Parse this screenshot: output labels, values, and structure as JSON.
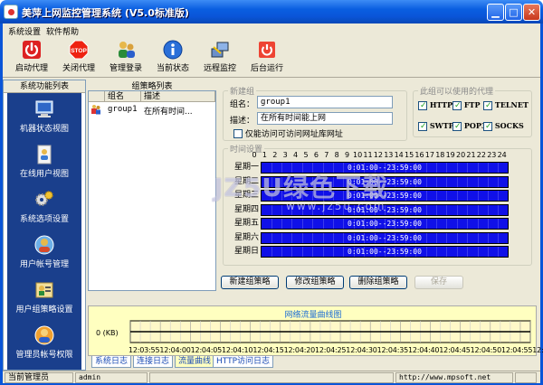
{
  "window": {
    "title": "美萍上网监控管理系统 (V5.0标准版)"
  },
  "menu": {
    "items": [
      "系统设置",
      "软件帮助"
    ]
  },
  "toolbar": {
    "items": [
      {
        "label": "启动代理",
        "icon": "power-on-icon"
      },
      {
        "label": "关闭代理",
        "icon": "stop-sign-icon"
      },
      {
        "label": "管理登录",
        "icon": "admin-login-icon"
      },
      {
        "label": "当前状态",
        "icon": "info-icon"
      },
      {
        "label": "远程监控",
        "icon": "remote-monitor-icon"
      },
      {
        "label": "后台运行",
        "icon": "background-run-icon"
      }
    ]
  },
  "left_panel": {
    "title": "系统功能列表",
    "items": [
      {
        "label": "机器状态视图",
        "icon": "computer-icon"
      },
      {
        "label": "在线用户视图",
        "icon": "user-online-icon"
      },
      {
        "label": "系统选项设置",
        "icon": "settings-gears-icon"
      },
      {
        "label": "用户帐号管理",
        "icon": "user-account-icon"
      },
      {
        "label": "用户组策略设置",
        "icon": "group-policy-icon"
      },
      {
        "label": "管理员帐号权限",
        "icon": "admin-account-icon"
      }
    ]
  },
  "group_list": {
    "title": "组策略列表",
    "columns": [
      "组名",
      "描述"
    ],
    "rows": [
      {
        "name": "group1",
        "desc": "在所有时间..."
      }
    ]
  },
  "new_group": {
    "legend": "新建组",
    "name_label": "组名：",
    "name_value": "group1",
    "desc_label": "描述：",
    "desc_value": "在所有时间能上网",
    "checkbox_label": "仅能访问可访问网址库网址",
    "checkbox_checked": false
  },
  "protocols": {
    "legend": "此组可以使用的代理",
    "items": [
      {
        "label": "HTTP",
        "checked": true
      },
      {
        "label": "FTP",
        "checked": true
      },
      {
        "label": "TELNET",
        "checked": true
      },
      {
        "label": "SWTP",
        "checked": true
      },
      {
        "label": "POP3",
        "checked": true
      },
      {
        "label": "SOCKS",
        "checked": true
      }
    ]
  },
  "time_settings": {
    "legend": "时间设置",
    "hours": [
      "0",
      "1",
      "2",
      "3",
      "4",
      "5",
      "6",
      "7",
      "8",
      "9",
      "10",
      "11",
      "12",
      "13",
      "14",
      "15",
      "16",
      "17",
      "18",
      "19",
      "20",
      "21",
      "22",
      "23",
      "24"
    ],
    "days": [
      {
        "day": "星期一",
        "range": "0:01:00--23:59:00"
      },
      {
        "day": "星期二",
        "range": "0:01:00--23:59:00"
      },
      {
        "day": "星期三",
        "range": "0:01:00--23:59:00"
      },
      {
        "day": "星期四",
        "range": "0:01:00--23:59:00"
      },
      {
        "day": "星期五",
        "range": "0:01:00--23:59:00"
      },
      {
        "day": "星期六",
        "range": "0:01:00--23:59:00"
      },
      {
        "day": "星期日",
        "range": "0:01:00--23:59:00"
      }
    ]
  },
  "actions": {
    "new_policy": "新建组策略",
    "edit_policy": "修改组策略",
    "delete_policy": "删除组策略",
    "save": "保存"
  },
  "traffic": {
    "title": "网络流量曲线图",
    "y_label": "0 (KB)",
    "time_axis": "12:03:5512:04:0012:04:0512:04:1012:04:1512:04:2012:04:2512:04:3012:04:3512:04:4012:04:4512:04:5012:04:5512:05:00"
  },
  "tabs": [
    "系统日志",
    "连接日志",
    "流量曲线",
    "HTTP访问日志"
  ],
  "active_tab": 2,
  "status": {
    "label": "当前管理员",
    "user": "admin",
    "url": "http://www.mpsoft.net"
  },
  "watermark": {
    "text": "JZ5U绿色下载",
    "url": "www.jz5u.com"
  }
}
